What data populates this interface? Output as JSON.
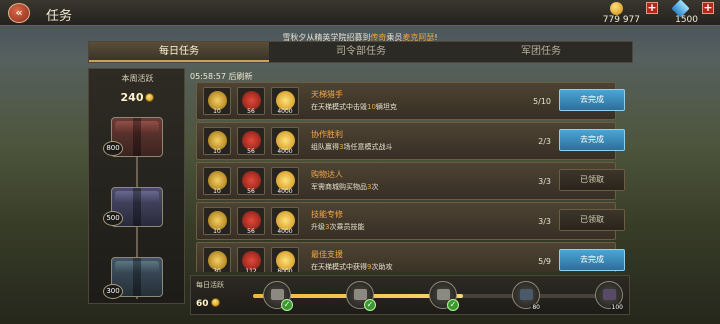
{
  "header": {
    "back_icon": "double-chevron-left-icon",
    "title": "任务"
  },
  "resources": [
    {
      "name": "gold-coin-icon",
      "value": "779 977",
      "color": "#f5c542"
    },
    {
      "name": "diamond-icon",
      "value": "1500",
      "color": "#49b6f0"
    }
  ],
  "notice": {
    "prefix": "雪秋夕从精英学院招募到",
    "highlight1": "传奇",
    "middle": "乘员",
    "highlight2": "麦克阿瑟",
    "suffix": "!"
  },
  "tabs": [
    {
      "label": "每日任务",
      "active": true
    },
    {
      "label": "司令部任务",
      "active": false
    },
    {
      "label": "军团任务",
      "active": false
    }
  ],
  "weekly": {
    "label": "本周活跃",
    "value": "240",
    "chests": [
      {
        "value": "800"
      },
      {
        "value": "500"
      },
      {
        "value": "300"
      }
    ]
  },
  "timer": "05:58:57 后刷新",
  "quests": [
    {
      "rewards": [
        "10",
        "56",
        "4000"
      ],
      "name": "天梯猎手",
      "desc_pre": "在天梯模式中击毁",
      "desc_hl": "10",
      "desc_post": "辆坦克",
      "progress": "5/10",
      "button": "去完成",
      "state": "go"
    },
    {
      "rewards": [
        "10",
        "56",
        "4000"
      ],
      "name": "协作胜利",
      "desc_pre": "组队赢得",
      "desc_hl": "3",
      "desc_post": "场任意模式战斗",
      "progress": "2/3",
      "button": "去完成",
      "state": "go"
    },
    {
      "rewards": [
        "10",
        "56",
        "4000"
      ],
      "name": "购物达人",
      "desc_pre": "军需商城购买物品",
      "desc_hl": "3",
      "desc_post": "次",
      "progress": "3/3",
      "button": "已领取",
      "state": "done"
    },
    {
      "rewards": [
        "10",
        "56",
        "4000"
      ],
      "name": "技能专修",
      "desc_pre": "升级",
      "desc_hl": "3",
      "desc_post": "次乘员技能",
      "progress": "3/3",
      "button": "已领取",
      "state": "done"
    },
    {
      "rewards": [
        "30",
        "112",
        "8000"
      ],
      "name": "最佳支援",
      "desc_pre": "在天梯模式中获得",
      "desc_hl": "9",
      "desc_post": "次助攻",
      "progress": "5/9",
      "button": "去完成",
      "state": "go"
    }
  ],
  "daily": {
    "label": "每日活跃",
    "value": "60",
    "progress_fraction": 0.6,
    "milestones": [
      {
        "claimed": true,
        "value": ""
      },
      {
        "claimed": true,
        "value": ""
      },
      {
        "claimed": true,
        "value": ""
      },
      {
        "claimed": false,
        "value": "80"
      },
      {
        "claimed": false,
        "value": "100"
      }
    ]
  }
}
